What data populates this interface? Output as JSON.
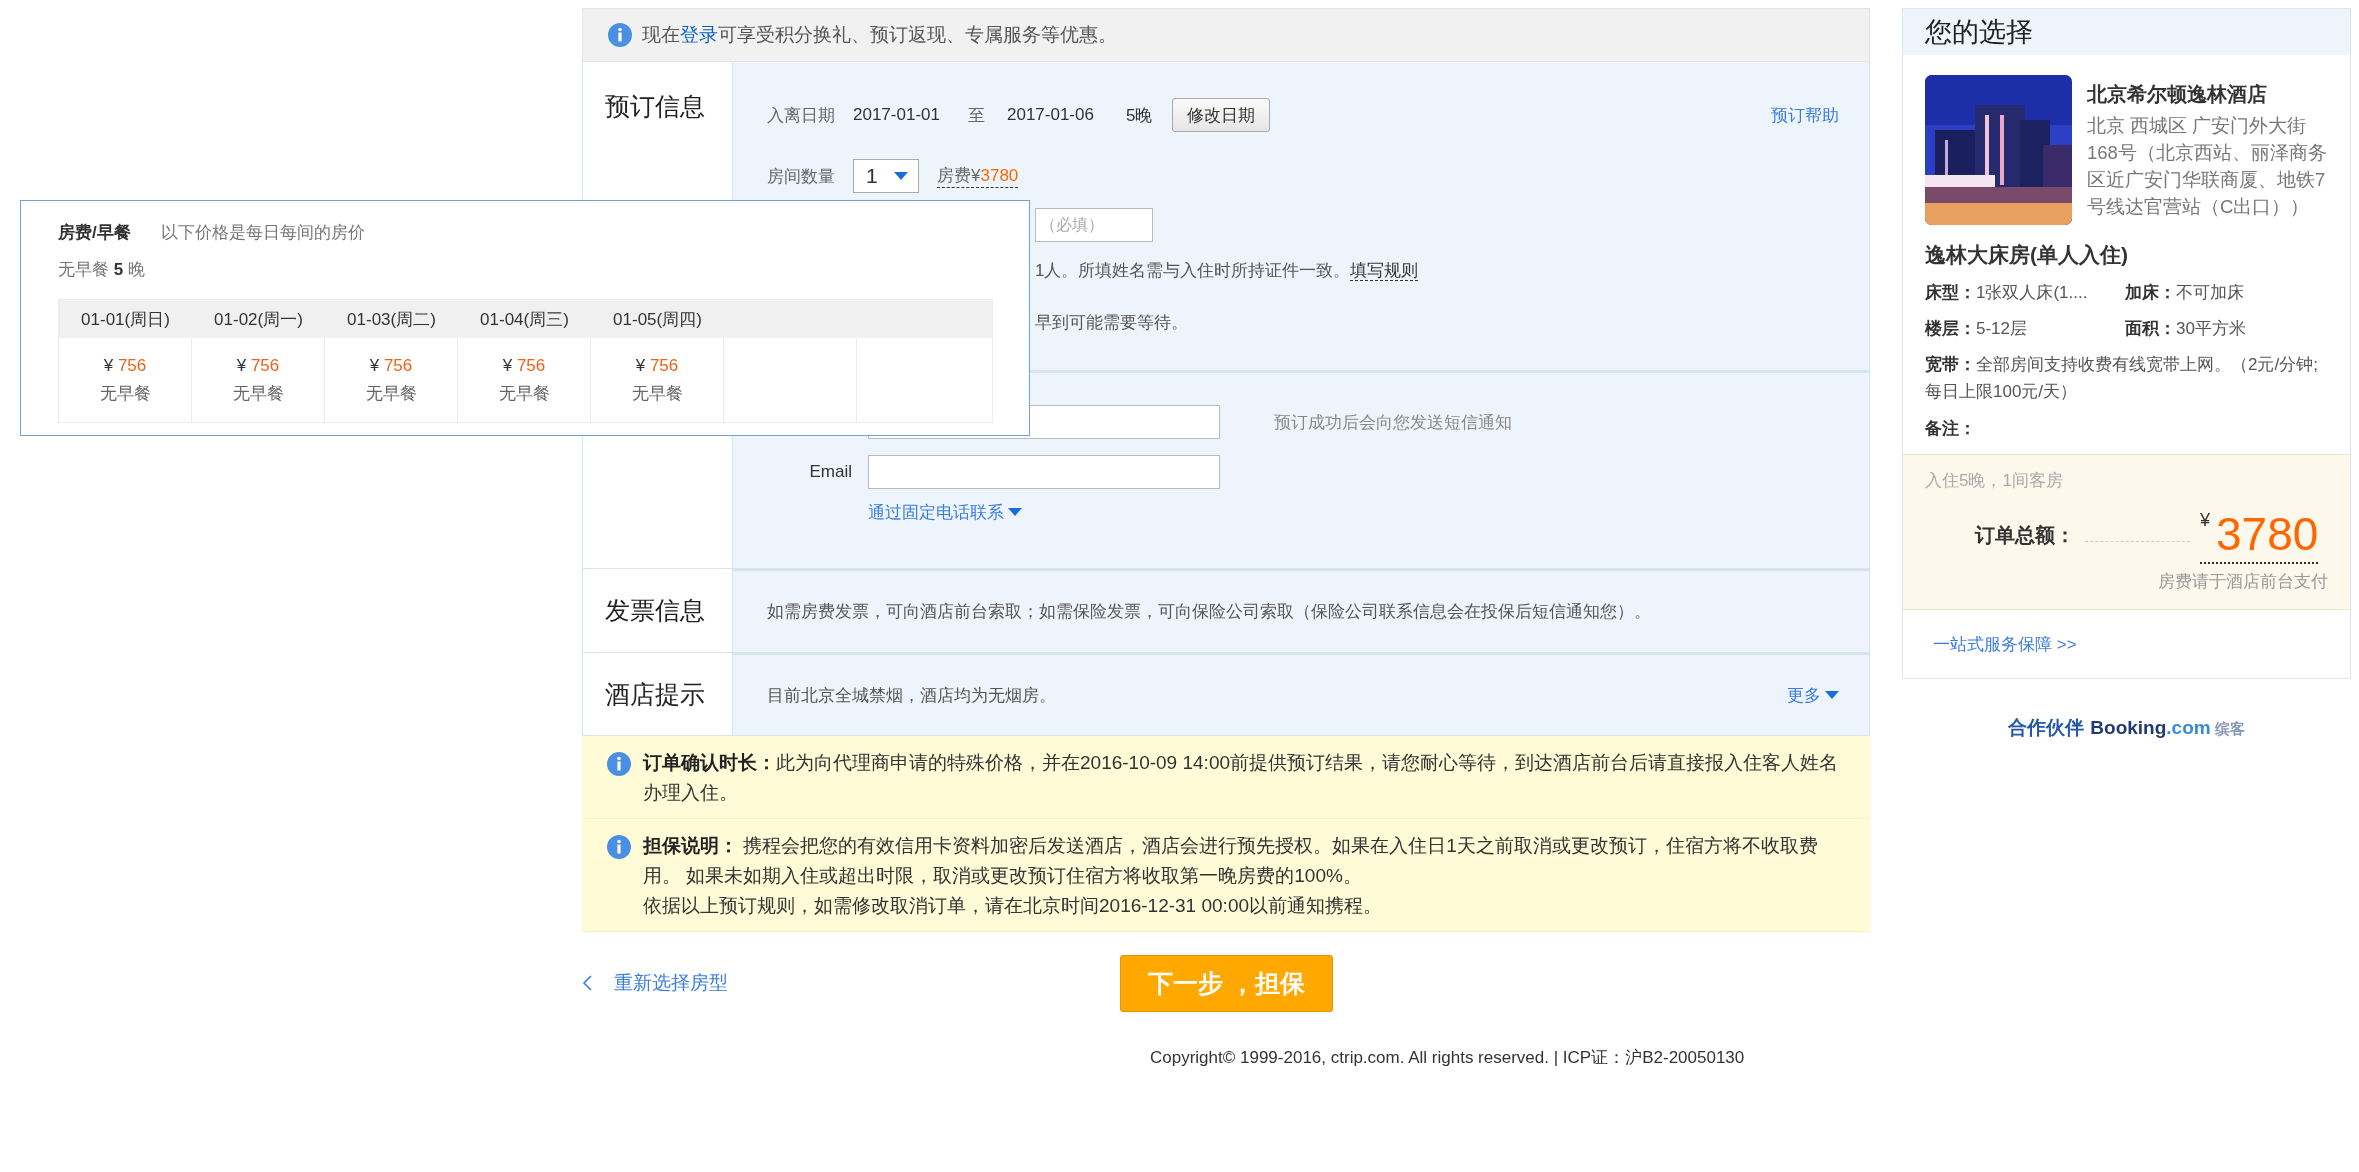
{
  "notice": {
    "before": "现在",
    "link": "登录",
    "after": "可享受积分换礼、预订返现、专属服务等优惠。"
  },
  "booking": {
    "label": "预订信息",
    "dates_label": "入离日期",
    "checkin": "2017-01-01",
    "to": "至",
    "checkout": "2017-01-06",
    "nights": "5晚",
    "change_button": "修改日期",
    "help_link": "预订帮助",
    "rooms_label": "房间数量",
    "rooms_value": "1",
    "fee_label": "房费¥",
    "fee_amount": "3780",
    "guest_placeholder": "（必填）",
    "guest_note": "1人。所填姓名需与入住时所持证件一致。",
    "rules_link": "填写规则",
    "arrival_note": "早到可能需要等待。"
  },
  "contact": {
    "sms_note": "预订成功后会向您发送短信通知",
    "email_label": "Email",
    "landline_link": "通过固定电话联系"
  },
  "invoice": {
    "label": "发票信息",
    "text": "如需房费发票，可向酒店前台索取；如需保险发票，可向保险公司索取（保险公司联系信息会在投保后短信通知您）。"
  },
  "hotel_tips": {
    "label": "酒店提示",
    "text": "目前北京全城禁烟，酒店均为无烟房。",
    "more_link": "更多"
  },
  "notes": [
    {
      "lines": [
        "**订单确认时长：**此为向代理商申请的特殊价格，并在2016-10-09 14:00前提供预订结果，请您耐心等待，到达酒店前台后请直接报入住客人姓名办理入住。"
      ]
    },
    {
      "lines": [
        "**担保说明：** 携程会把您的有效信用卡资料加密后发送酒店，酒店会进行预先授权。如果在入住日1天之前取消或更改预订，住宿方将不收取费用。 如果未如期入住或超出时限，取消或更改预订住宿方将收取第一晚房费的100%。",
        "依据以上预订规则，如需修改取消订单，请在北京时间2016-12-31 00:00以前通知携程。"
      ]
    }
  ],
  "actions": {
    "back_link": "重新选择房型",
    "next_button": "下一步 ，担保"
  },
  "footer": "Copyright© 1999-2016, ctrip.com. All rights reserved. | ICP证：沪B2-20050130",
  "price_popup": {
    "title": "房费/早餐",
    "subtitle": "以下价格是每日每间的房价",
    "meal_nights": "无早餐 **5** 晚",
    "currency": "¥ ",
    "days": [
      {
        "date": "01-01(周日)",
        "price": "756",
        "meal": "无早餐"
      },
      {
        "date": "01-02(周一)",
        "price": "756",
        "meal": "无早餐"
      },
      {
        "date": "01-03(周二)",
        "price": "756",
        "meal": "无早餐"
      },
      {
        "date": "01-04(周三)",
        "price": "756",
        "meal": "无早餐"
      },
      {
        "date": "01-05(周四)",
        "price": "756",
        "meal": "无早餐"
      }
    ]
  },
  "selection": {
    "title": "您的选择",
    "hotel_name": "北京希尔顿逸林酒店",
    "address": "北京 西城区 广安门外大街168号（北京西站、丽泽商务区近广安门华联商厦、地铁7号线达官营站（C出口））",
    "room_name": "逸林大床房(单人入住)",
    "facts": [
      "**床型：**1张双人床(1....",
      "**加床：**不可加床",
      "**楼层：**5-12层",
      "**面积：**30平方米"
    ],
    "broadband": "**宽带：**全部房间支持收费有线宽带上网。（2元/分钟;每日上限100元/天）",
    "remark": "备注：",
    "stay_summary": "入住5晚，1间客房",
    "total_label": "订单总额：",
    "currency": "¥",
    "total_amount": "3780",
    "pay_note": "房费请于酒店前台支付",
    "service_link": "一站式服务保障 >>"
  },
  "partner": {
    "label": "合作伙伴",
    "brand_main": "Booking",
    "brand_suffix": ".com",
    "brand_cn": "缤客"
  }
}
